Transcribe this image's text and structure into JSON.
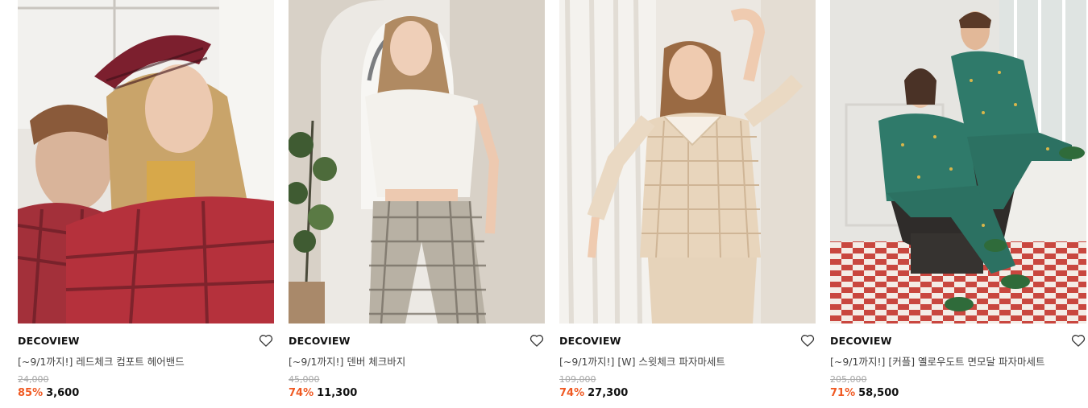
{
  "colors": {
    "discount": "#f05a23",
    "text": "#111111",
    "original_price": "#a8a8a8"
  },
  "products": [
    {
      "brand": "DECOVIEW",
      "title": "[~9/1까지!] 레드체크 컴포트 헤어밴드",
      "original_price": "24,000",
      "discount": "85%",
      "price": "3,600",
      "icon": "heart-outline-icon"
    },
    {
      "brand": "DECOVIEW",
      "title": "[~9/1까지!] 덴버 체크바지",
      "original_price": "45,000",
      "discount": "74%",
      "price": "11,300",
      "icon": "heart-outline-icon"
    },
    {
      "brand": "DECOVIEW",
      "title": "[~9/1까지!] [W] 스윗체크 파자마세트",
      "original_price": "109,000",
      "discount": "74%",
      "price": "27,300",
      "icon": "heart-outline-icon"
    },
    {
      "brand": "DECOVIEW",
      "title": "[~9/1까지!] [커플] 옐로우도트 면모달 파자마세트",
      "original_price": "205,000",
      "discount": "71%",
      "price": "58,500",
      "icon": "heart-outline-icon"
    }
  ]
}
